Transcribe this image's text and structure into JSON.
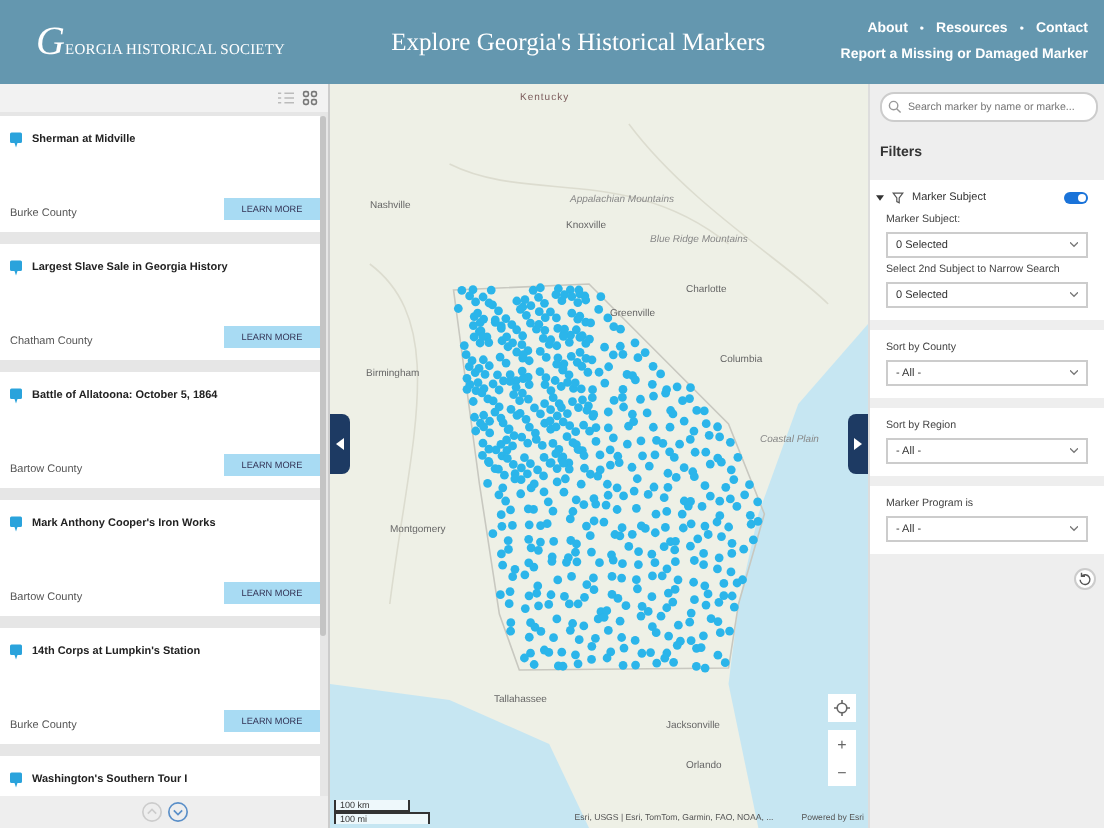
{
  "header": {
    "logo": "GEORGIA HISTORICAL SOCIETY",
    "title": "Explore Georgia's Historical Markers",
    "nav": [
      "About",
      "Resources",
      "Contact"
    ],
    "nav_separator": "•",
    "report_link": "Report a Missing or Damaged Marker"
  },
  "list_panel": {
    "cards": [
      {
        "title": "Sherman at Midville",
        "county": "Burke County",
        "button": "LEARN MORE"
      },
      {
        "title": "Largest Slave Sale in Georgia History",
        "county": "Chatham County",
        "button": "LEARN MORE"
      },
      {
        "title": "Battle of Allatoona: October 5, 1864",
        "county": "Bartow County",
        "button": "LEARN MORE"
      },
      {
        "title": "Mark Anthony Cooper's Iron Works",
        "county": "Bartow County",
        "button": "LEARN MORE"
      },
      {
        "title": "14th Corps at Lumpkin's Station",
        "county": "Burke County",
        "button": "LEARN MORE"
      },
      {
        "title": "Washington's Southern Tour I"
      }
    ]
  },
  "map": {
    "place_labels": [
      "Kentucky",
      "Nashville",
      "Knoxville",
      "Appalachian Mountains",
      "Blue Ridge Mountains",
      "Charlotte",
      "Greenville",
      "Columbia",
      "Birmingham",
      "Coastal Plain",
      "Montgomery",
      "Tallahassee",
      "Jacksonville",
      "Orlando"
    ],
    "zoom_buttons": [
      "+",
      "−"
    ],
    "scale": [
      "100 km",
      "100 mi"
    ],
    "attribution": "Esri, USGS | Esri, TomTom, Garmin, FAO, NOAA, ...",
    "powered_by": "Powered by Esri"
  },
  "filters": {
    "search_placeholder": "Search marker by name or marke...",
    "heading": "Filters",
    "sections": [
      {
        "kind": "subject",
        "title": "Marker Subject",
        "on": true,
        "expanded": true,
        "fields": [
          {
            "label": "Marker Subject:",
            "value": "0 Selected"
          },
          {
            "label": "Select 2nd Subject to Narrow Search",
            "value": "0 Selected"
          }
        ]
      },
      {
        "kind": "select",
        "fields": [
          {
            "label": "Sort by County",
            "value": "- All -"
          }
        ]
      },
      {
        "kind": "select",
        "fields": [
          {
            "label": "Sort by Region",
            "value": "- All -"
          }
        ]
      },
      {
        "kind": "select",
        "fields": [
          {
            "label": "Marker Program is",
            "value": "- All -"
          }
        ]
      }
    ]
  }
}
